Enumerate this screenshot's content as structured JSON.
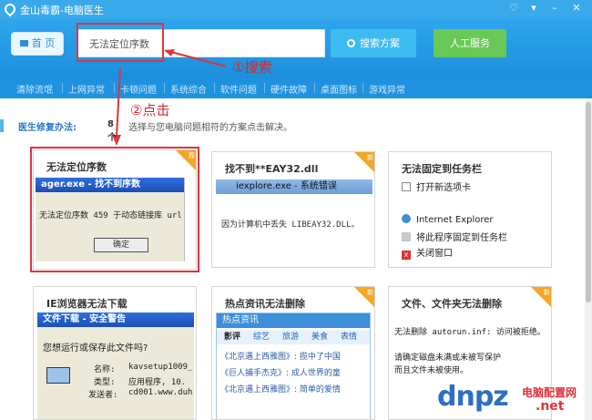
{
  "window": {
    "title": "金山毒霸-电脑医生",
    "controls": [
      "♡",
      "▾",
      "–",
      "✕"
    ]
  },
  "header": {
    "home_label": "首 页",
    "search_placeholder": "无法定位序数",
    "search_button": "搜索方案",
    "service_button": "人工服务"
  },
  "categories": [
    "清除流氓",
    "上网异常",
    "卡顿问题",
    "系统综合",
    "软件问题",
    "硬件故障",
    "桌面图标",
    "游戏异常"
  ],
  "annotations": {
    "step1": "①搜索",
    "step2": "②点击"
  },
  "section": {
    "label": "医生修复办法:",
    "count": "8个",
    "hint": "选择与您电脑问题相符的方案点击解决。"
  },
  "badges": {
    "recommend": "荐",
    "new": "新"
  },
  "cards": [
    {
      "title": "无法定位序数",
      "bar_text": "ager.exe - 找不到序数",
      "message": "无法定位序数 459 于动态链接库 url",
      "ok_label": "确定"
    },
    {
      "title": "找不到**EAY32.dll",
      "bar_text": "iexplore.exe - 系统错误",
      "message": "因为计算机中丢失 LIBEAY32.DLL。"
    },
    {
      "title": "无法固定到任务栏",
      "items": [
        "打开新选项卡",
        "Internet Explorer",
        "将此程序固定到任务栏",
        "关闭窗口"
      ]
    },
    {
      "title": "IE浏览器无法下载",
      "bar_text": "文件下载 - 安全警告",
      "question": "您想运行或保存此文件吗?",
      "rows": [
        {
          "k": "名称:",
          "v": "kavsetup1009_"
        },
        {
          "k": "类型:",
          "v": "应用程序, 10."
        },
        {
          "k": "发送者:",
          "v": "cd001.www.duh"
        }
      ]
    },
    {
      "title": "热点资讯无法删除",
      "panel_title": "热点资讯",
      "tabs": [
        "影评",
        "综艺",
        "旅游",
        "美食",
        "表情"
      ],
      "news": [
        "《北京遇上西雅图》: 揽中了中国",
        "《巨人捕手杰克》: 成人世界的童",
        "《北京遇上西雅图》: 简单的爱情"
      ]
    },
    {
      "title": "文件、文件夹无法删除",
      "line1": "无法删除 autorun.inf: 访问被拒绝。",
      "line2": "请确定磁盘未满或未被写保护",
      "line3": "而且文件未被使用。"
    }
  ],
  "watermark": {
    "brand": "dnpz",
    "site": "电脑配置网",
    "domain": ".net"
  },
  "colors": {
    "titlebar": "#3aa9e9",
    "header": "#1c8fdc",
    "accent_red": "#e1333d",
    "badge": "#f5a623"
  }
}
